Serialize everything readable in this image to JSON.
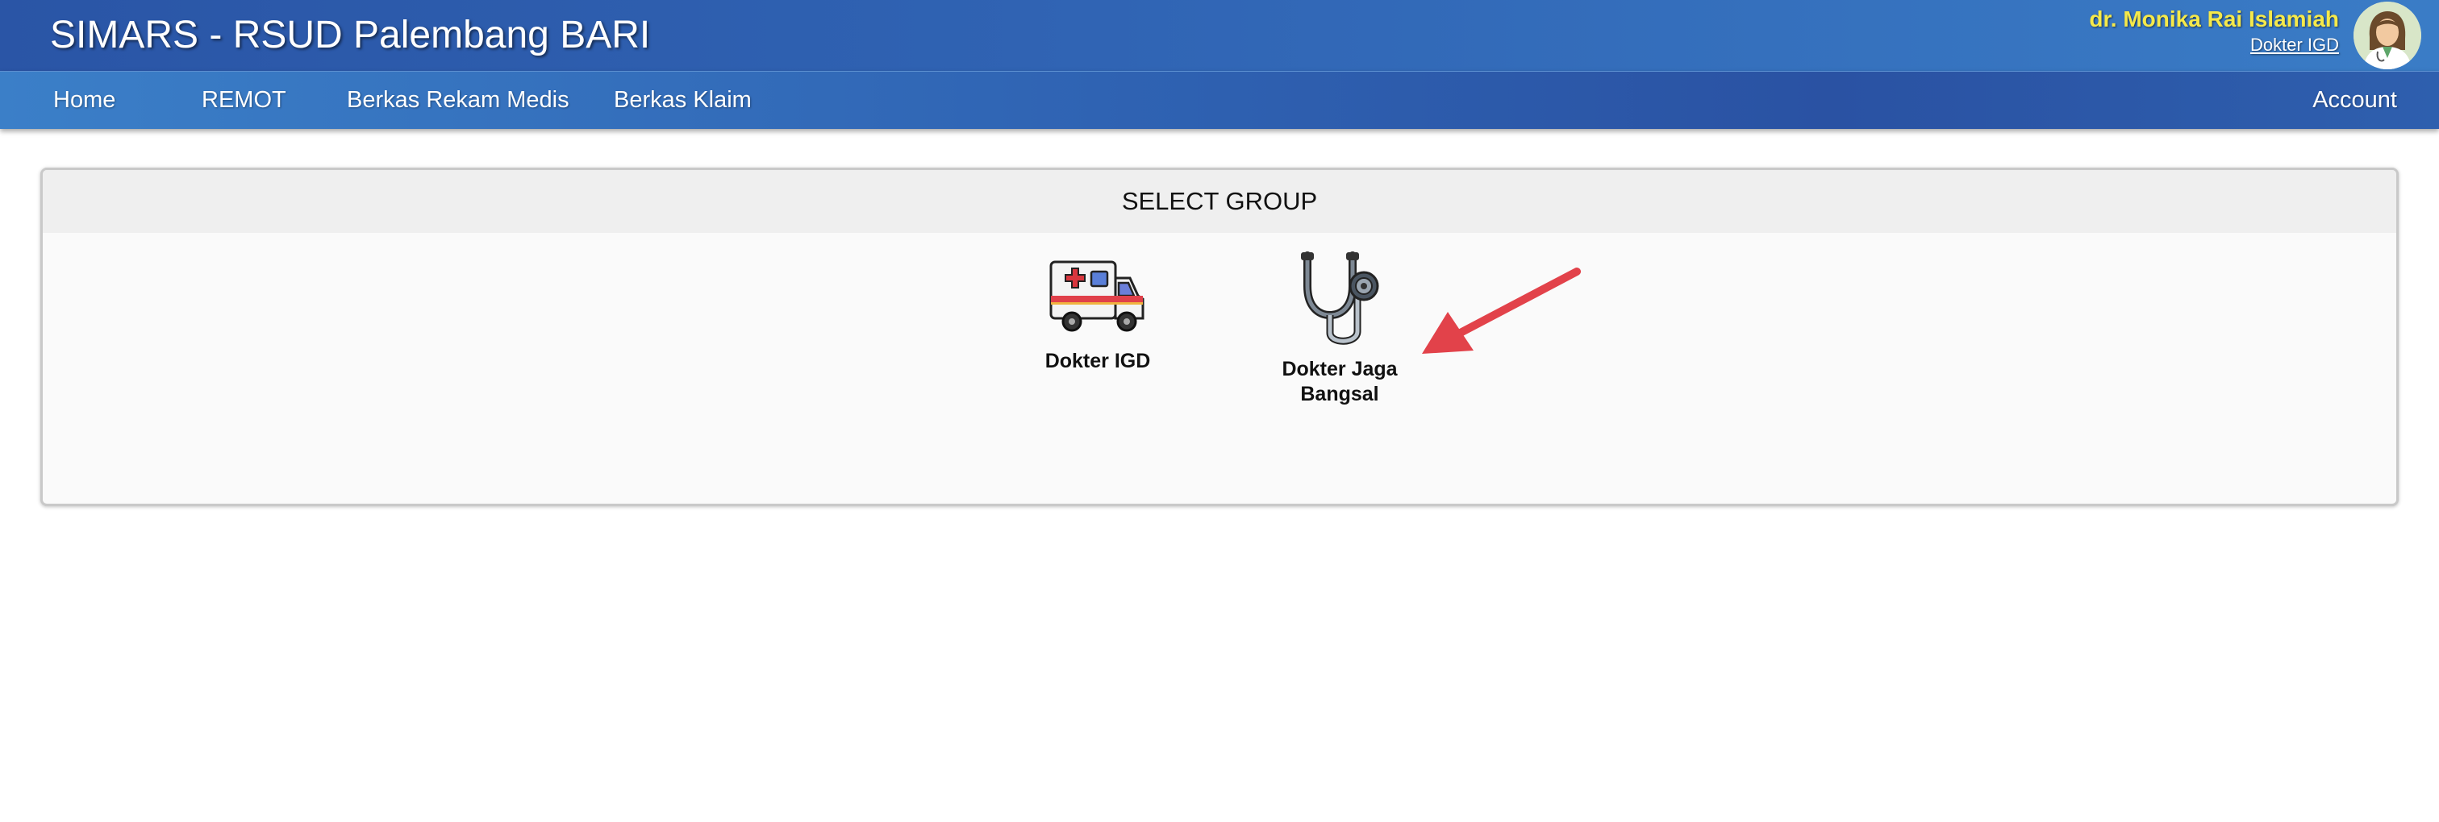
{
  "header": {
    "app_title": "SIMARS - RSUD Palembang BARI",
    "user_name": "dr. Monika Rai Islamiah",
    "user_role": "Dokter IGD",
    "avatar_icon": "female-doctor-avatar"
  },
  "nav": {
    "items": [
      {
        "label": "Home"
      },
      {
        "label": "REMOT"
      },
      {
        "label": "Berkas Rekam Medis"
      },
      {
        "label": "Berkas Klaim"
      }
    ],
    "account_label": "Account"
  },
  "panel": {
    "title": "SELECT GROUP",
    "groups": [
      {
        "label": "Dokter IGD",
        "icon": "ambulance-icon"
      },
      {
        "label": "Dokter Jaga\nBangsal",
        "icon": "stethoscope-icon"
      }
    ]
  },
  "colors": {
    "topbar": "#2a55a6",
    "navbar": "#3064b4",
    "user_name": "#f5e94a",
    "annotation_arrow": "#e2424a"
  }
}
